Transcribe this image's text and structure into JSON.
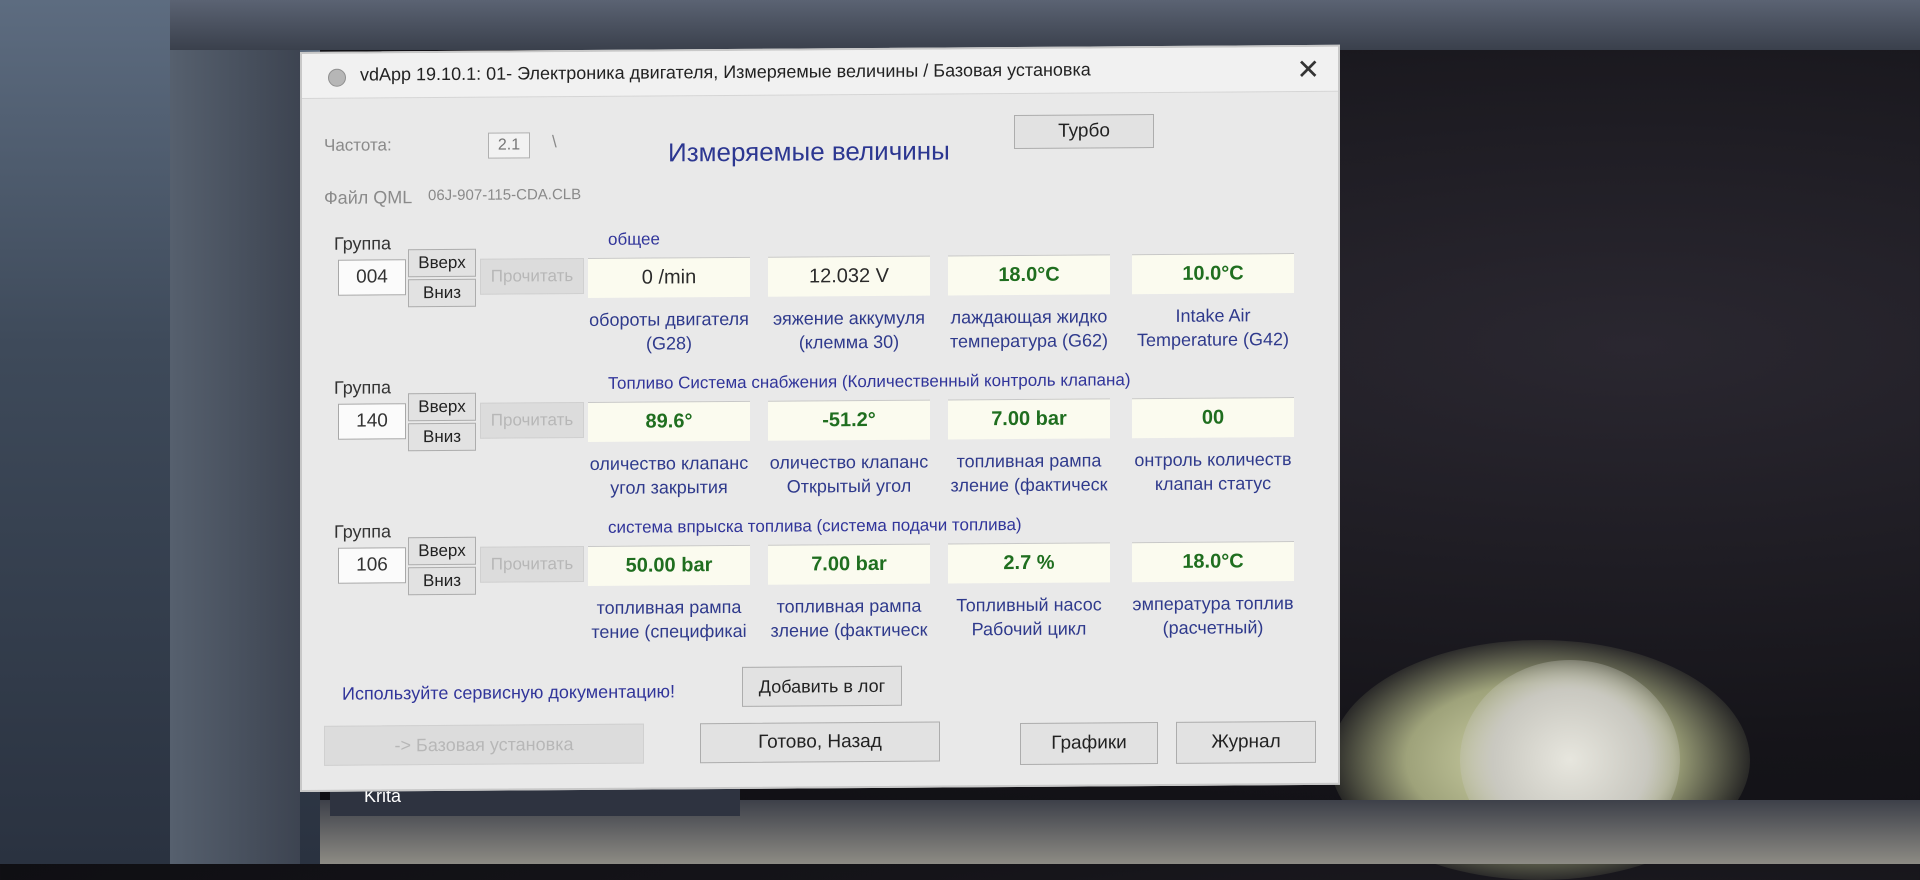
{
  "window": {
    "title": "vdApp 19.10.1: 01- Электроника двигателя,  Измеряемые величины / Базовая установка"
  },
  "header": {
    "freq_label": "Частота:",
    "freq_value": "2.1",
    "freq_sep": "\\",
    "turbo_button": "Турбо",
    "main_title": "Измеряемые величины",
    "qml_label": "Файл QML",
    "qml_file": "06J-907-115-CDA.CLB"
  },
  "groups": [
    {
      "label": "Группа",
      "number": "004",
      "up": "Вверх",
      "down": "Вниз",
      "read": "Прочитать",
      "heading": "общее",
      "values": [
        "0 /min",
        "12.032 V",
        "18.0°C",
        "10.0°C"
      ],
      "desc1": [
        "обороты двигателя",
        "эяжение аккумуля",
        "лаждающая жидко",
        "Intake Air"
      ],
      "desc2": [
        "(G28)",
        "(клемма 30)",
        "температура (G62)",
        "Temperature (G42)"
      ]
    },
    {
      "label": "Группа",
      "number": "140",
      "up": "Вверх",
      "down": "Вниз",
      "read": "Прочитать",
      "heading": "Топливо Система снабжения (Количественный контроль клапана)",
      "values": [
        "89.6°",
        "-51.2°",
        "7.00 bar",
        "00"
      ],
      "desc1": [
        "оличество клапанс",
        "оличество клапанс",
        "топливная рампа",
        "онтроль количеств"
      ],
      "desc2": [
        "угол закрытия",
        "Открытый угол",
        "зление (фактическ",
        "клапан статус"
      ]
    },
    {
      "label": "Группа",
      "number": "106",
      "up": "Вверх",
      "down": "Вниз",
      "read": "Прочитать",
      "heading": "система впрыска топлива (система подачи топлива)",
      "values": [
        "50.00 bar",
        "7.00 bar",
        "2.7 %",
        "18.0°C"
      ],
      "desc1": [
        "топливная рампа",
        "топливная рампа",
        "Топливный насос",
        "эмпература топлив"
      ],
      "desc2": [
        "тение (спецификаі",
        "зление (фактическ",
        "Рабочий цикл",
        "(расчетный)"
      ]
    }
  ],
  "footer": {
    "service_note": "Используйте сервисную документацию!",
    "add_log": "Добавить в лог",
    "basic_setting": "-> Базовая установка",
    "done_back": "Готово, Назад",
    "graphs": "Графики",
    "journal": "Журнал"
  },
  "taskbar": {
    "app": "Krita"
  }
}
